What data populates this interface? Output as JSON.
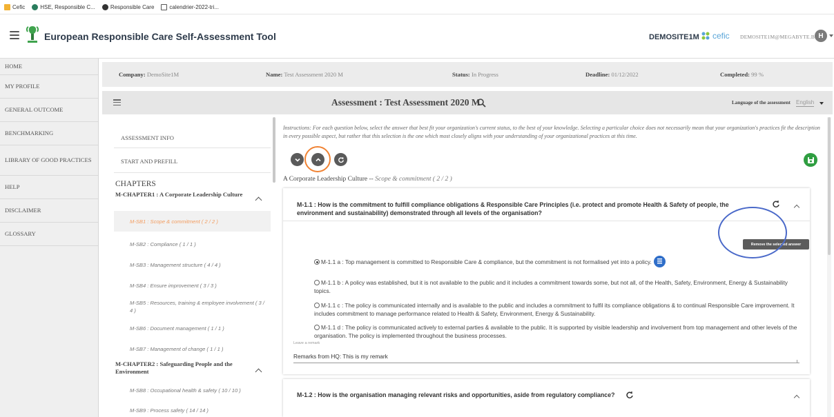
{
  "bookmarks": [
    {
      "label": "Cefic",
      "icon": "folder-icon",
      "color": "#f2b233"
    },
    {
      "label": "HSE, Responsible C...",
      "icon": "hse-icon",
      "color": "#2a7d5d"
    },
    {
      "label": "Responsible Care",
      "icon": "rc-icon",
      "color": "#333333"
    },
    {
      "label": "calendrier-2022-tri...",
      "icon": "document-icon",
      "color": "#555555"
    }
  ],
  "header": {
    "title": "European Responsible Care Self-Assessment Tool",
    "site": "DEMOSITE1M",
    "partner": "cefic",
    "email": "DEMOSITE1M@MEGABYTE.BE",
    "avatar": "H"
  },
  "nav": [
    "HOME",
    "MY PROFILE",
    "GENERAL OUTCOME",
    "BENCHMARKING",
    "LIBRARY OF GOOD PRACTICES",
    "HELP",
    "DISCLAIMER",
    "GLOSSARY"
  ],
  "info": {
    "company_label": "Company:",
    "company": "DemoSite1M",
    "name_label": "Name:",
    "name": "Test Assessment 2020 M",
    "status_label": "Status:",
    "status": "In Progress",
    "deadline_label": "Deadline:",
    "deadline": "01/12/2022",
    "completed_label": "Completed:",
    "completed": "99 %"
  },
  "assessment": {
    "title": "Assessment : Test Assessment 2020 M",
    "language_label": "Language of the assessment",
    "language": "English"
  },
  "chapters": {
    "links": [
      "ASSESSMENT INFO",
      "START AND PREFILL"
    ],
    "header": "CHAPTERS",
    "groups": [
      {
        "title": "M-CHAPTER1 : A Corporate Leadership Culture"
      },
      {
        "title": "M-CHAPTER2 : Safeguarding People and the Environment"
      }
    ],
    "items": [
      "M-SB1 : Scope & commitment ( 2 / 2 )",
      "M-SB2 : Compliance ( 1 / 1 )",
      "M-SB3 : Management structure ( 4 / 4 )",
      "M-SB4 : Ensure improvement ( 3 / 3 )",
      "M-SB5 : Resources, training & employee involvement ( 3 / 4 )",
      "M-SB6 : Document management ( 1 / 1 )",
      "M-SB7 : Management of change ( 1 / 1 )",
      "M-SB8 : Occupational health & safety ( 10 / 10 )",
      "M-SB9 : Process safety ( 14 / 14 )"
    ]
  },
  "instructions": "Instructions: For each question below, select the answer that best fit your organization's current status, to the best of your knowledge. Selecting a particular choice does not necessarily mean that your organization's practices fit the description in every possible aspect, but rather that this selection is the one which most closely aligns with your understanding of your organizational practices at this time.",
  "breadcrumb": {
    "main": "A Corporate Leadership Culture -- ",
    "sub": "Scope & commitment ( 2 / 2 )"
  },
  "question1": {
    "title": "M-1.1 : How is the commitment to fulfill compliance obligations & Responsible Care Principles (i.e. protect and promote Health & Safety of people, the environment and sustainability) demonstrated through all levels of the organisation?",
    "tooltip": "Remove the selected answer",
    "options": [
      "M-1.1 a : Top management is committed to Responsible Care & compliance, but the commitment is not formalised yet into a policy.",
      "M-1.1 b : A policy was established, but it is not available to the public and it includes a commitment towards some, but not all, of the Health, Safety, Environment, Energy & Sustainability topics.",
      "M-1.1 c : The policy is communicated internally and is available to the public and includes a commitment to fulfil its compliance obligations & to continual Responsible Care improvement. It includes commitment to manage performance related to Health & Safety, Environment, Energy & Sustainability.",
      "M-1.1 d : The policy is communicated actively to external parties & available to the public. It is supported by visible leadership and involvement from top management and other levels of the organisation. The policy is implemented throughout the business processes."
    ],
    "remark_label": "Leave a remark",
    "remark": "Remarks from HQ: This is my remark"
  },
  "question2": {
    "title": "M-1.2 : How is the organisation managing relevant risks and opportunities, aside from regulatory compliance?"
  },
  "colors": {
    "accent_orange": "#f08232",
    "save_green": "#2f9e41",
    "annotation_blue": "#4a69c9",
    "nav_bg": "#efefef"
  }
}
